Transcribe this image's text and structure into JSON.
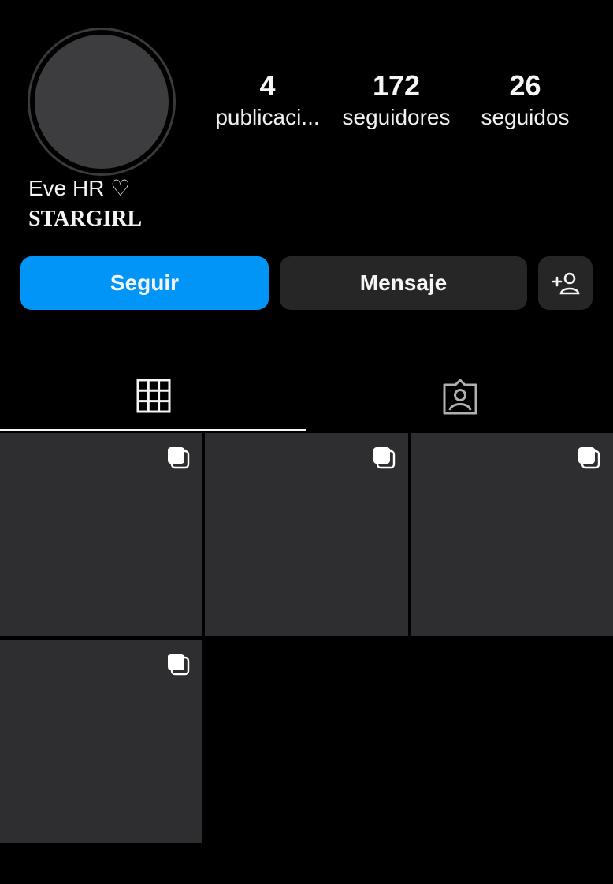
{
  "profile": {
    "display_name": "Eve HR ♡",
    "bio": "STARGIRL",
    "stats": [
      {
        "value": "4",
        "label": "publicaci..."
      },
      {
        "value": "172",
        "label": "seguidores"
      },
      {
        "value": "26",
        "label": "seguidos"
      }
    ]
  },
  "actions": {
    "follow_label": "Seguir",
    "message_label": "Mensaje",
    "add_user_icon": "add-user-icon"
  },
  "tabs": [
    {
      "icon": "grid-icon",
      "active": true
    },
    {
      "icon": "tagged-person-icon",
      "active": false
    }
  ],
  "posts": [
    {
      "multi": true
    },
    {
      "multi": true
    },
    {
      "multi": true
    },
    {
      "multi": true
    }
  ],
  "colors": {
    "follow": "#0095f6",
    "secondary_button": "#262626",
    "background": "#000000"
  }
}
